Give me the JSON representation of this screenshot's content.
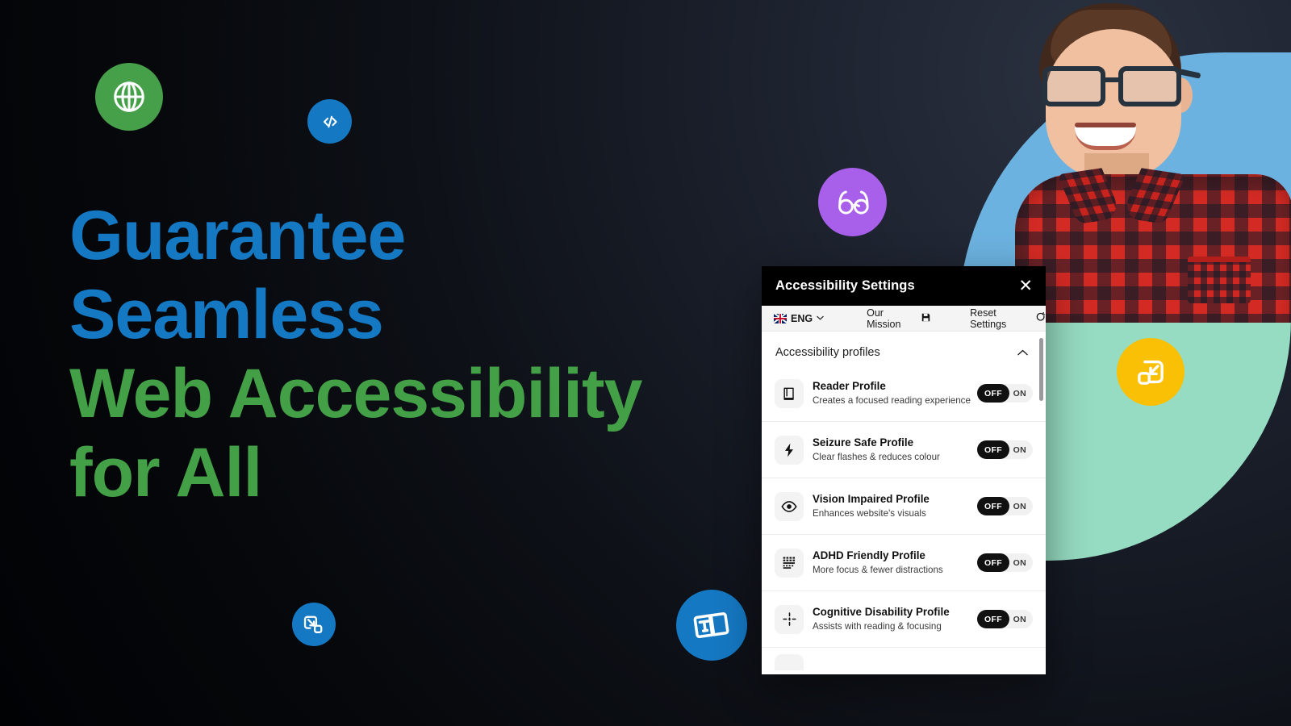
{
  "hero": {
    "headline_lines": [
      "Guarantee",
      "Seamless",
      "Web Accessibility",
      "for All"
    ],
    "colors": {
      "blue": "#1578c2",
      "green": "#43a047",
      "purple": "#a860ea",
      "yellow": "#fac005",
      "shape_blue": "#6cb2e0",
      "shape_teal": "#96dcc2",
      "background_dark": "#05070b",
      "background_navy": "#212733"
    }
  },
  "badges": [
    {
      "name": "globe-icon",
      "color": "#46a049"
    },
    {
      "name": "code-icon",
      "color": "#1578c2"
    },
    {
      "name": "glasses-icon",
      "color": "#a860ea"
    },
    {
      "name": "resize-icon",
      "color": "#fac005"
    },
    {
      "name": "text-size-icon",
      "color": "#1578c2"
    },
    {
      "name": "shrink-icon",
      "color": "#1578c2"
    }
  ],
  "widget": {
    "title": "Accessibility Settings",
    "close_label": "✕",
    "toolbar": {
      "language": "ENG",
      "language_chevron": "⌄",
      "mission_label": "Our Mission",
      "mission_icon": "💾",
      "reset_label": "Reset Settings",
      "reset_icon": "↻"
    },
    "section": {
      "title": "Accessibility profiles",
      "chevron": "∧"
    },
    "toggle": {
      "off_label": "OFF",
      "on_label": "ON"
    },
    "profiles": [
      {
        "icon": "book-icon",
        "name": "Reader Profile",
        "description": "Creates a focused reading experience",
        "state": "OFF"
      },
      {
        "icon": "bolt-icon",
        "name": "Seizure Safe Profile",
        "description": "Clear flashes & reduces colour",
        "state": "OFF"
      },
      {
        "icon": "eye-icon",
        "name": "Vision Impaired Profile",
        "description": "Enhances website's visuals",
        "state": "OFF"
      },
      {
        "icon": "grid-lines-icon",
        "name": "ADHD Friendly Profile",
        "description": "More focus & fewer distractions",
        "state": "OFF"
      },
      {
        "icon": "crosshair-icon",
        "name": "Cognitive Disability Profile",
        "description": "Assists with reading & focusing",
        "state": "OFF"
      }
    ]
  }
}
